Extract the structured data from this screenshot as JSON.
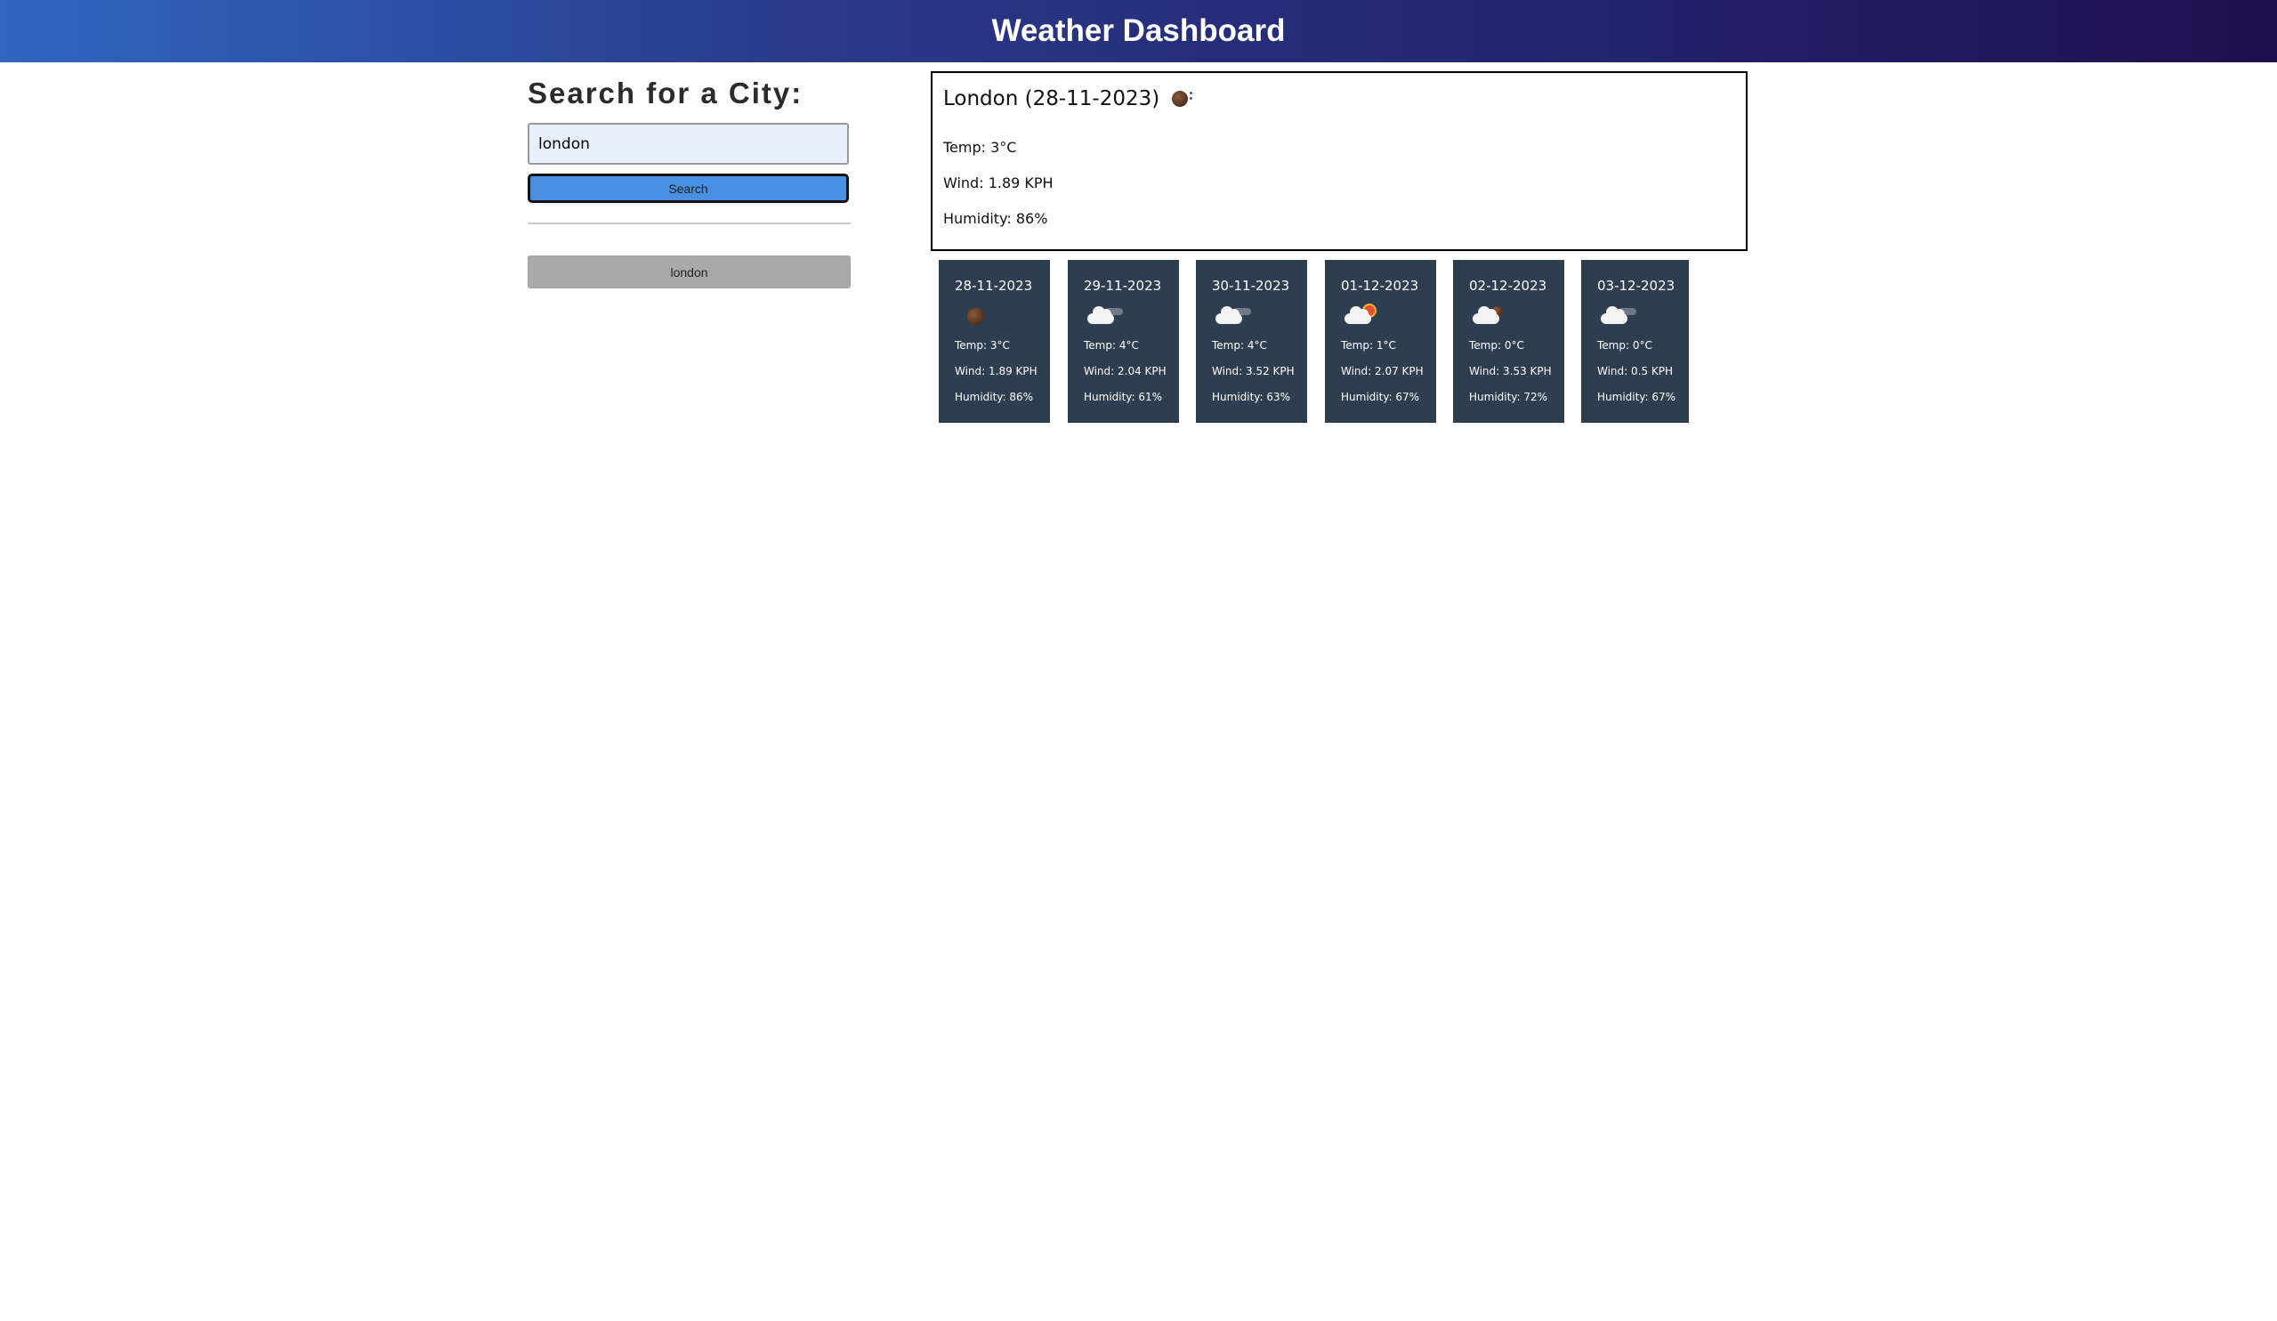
{
  "header": {
    "title": "Weather Dashboard"
  },
  "sidebar": {
    "heading": "Search for a City:",
    "search_value": "london",
    "search_button": "Search",
    "history": [
      "london"
    ]
  },
  "current": {
    "title": "London (28-11-2023)",
    "icon": "moon-icon",
    "temp": "Temp: 3°C",
    "wind": "Wind: 1.89 KPH",
    "humidity": "Humidity: 86%"
  },
  "forecast": [
    {
      "date": "28-11-2023",
      "icon": "night-icon",
      "temp": "Temp: 3°C",
      "wind": "Wind: 1.89 KPH",
      "humidity": "Humidity: 86%"
    },
    {
      "date": "29-11-2023",
      "icon": "night-cloud-icon",
      "temp": "Temp: 4°C",
      "wind": "Wind: 2.04 KPH",
      "humidity": "Humidity: 61%"
    },
    {
      "date": "30-11-2023",
      "icon": "night-cloud-icon",
      "temp": "Temp: 4°C",
      "wind": "Wind: 3.52 KPH",
      "humidity": "Humidity: 63%"
    },
    {
      "date": "01-12-2023",
      "icon": "sun-cloud-icon",
      "temp": "Temp: 1°C",
      "wind": "Wind: 2.07 KPH",
      "humidity": "Humidity: 67%"
    },
    {
      "date": "02-12-2023",
      "icon": "moon-cloud-icon",
      "temp": "Temp: 0°C",
      "wind": "Wind: 3.53 KPH",
      "humidity": "Humidity: 72%"
    },
    {
      "date": "03-12-2023",
      "icon": "night-cloud-icon",
      "temp": "Temp: 0°C",
      "wind": "Wind: 0.5 KPH",
      "humidity": "Humidity: 67%"
    }
  ]
}
